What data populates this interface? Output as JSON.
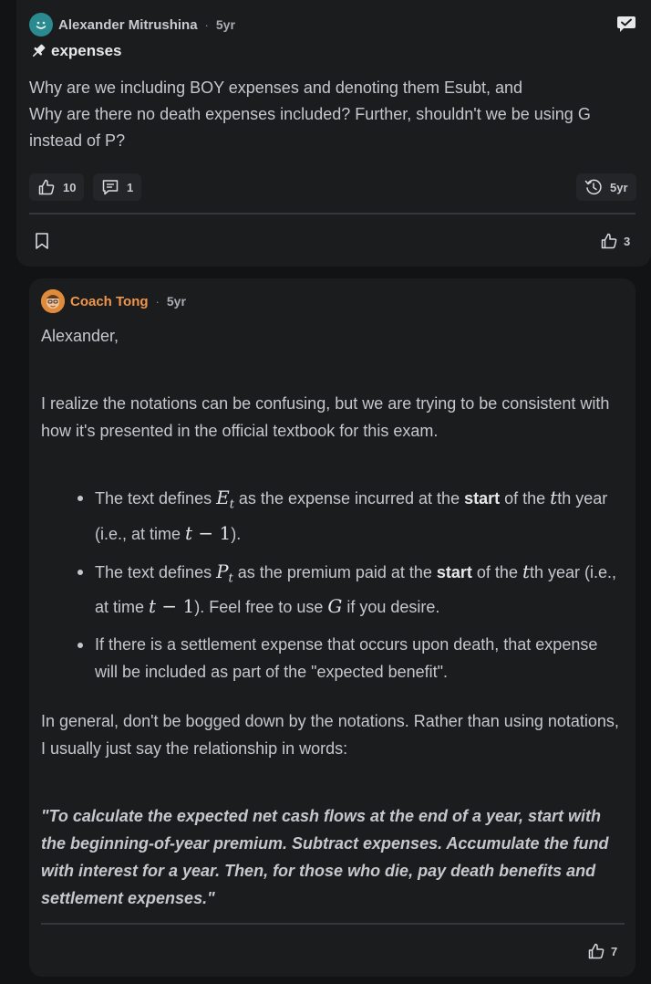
{
  "post": {
    "author": "Alexander Mitrushina",
    "time": "5yr",
    "title": "expenses",
    "body_line1": "Why are we including BOY expenses and denoting them Esubt, and",
    "body_line2": "Why are there no death expenses included? Further, shouldn't we be using G instead of P?",
    "likes": "10",
    "comments": "1",
    "history_label": "5yr",
    "reply_likes": "3"
  },
  "reply": {
    "author": "Coach Tong",
    "time": "5yr",
    "greeting": "Alexander,",
    "para1": "I realize the notations can be confusing, but we are trying to be consistent with how it's presented in the official textbook for this exam.",
    "b1_pre": "The text defines ",
    "b1_sym": "E",
    "b1_sub": "t",
    "b1_mid": " as the expense incurred at the ",
    "b1_bold": "start",
    "b1_of": " of the ",
    "b1_t": "t",
    "b1_th": "th year (i.e., at time ",
    "b1_expr": "t",
    "b1_expr2": " − 1",
    "b1_end": ").",
    "b2_pre": "The text defines ",
    "b2_sym": "P",
    "b2_sub": "t",
    "b2_mid": " as the premium paid at the ",
    "b2_bold": "start",
    "b2_of": " of the ",
    "b2_t": "t",
    "b2_th": "th year (i.e., at time ",
    "b2_expr": "t",
    "b2_expr2": " − 1",
    "b2_end": "). Feel free to use ",
    "b2_g": "G",
    "b2_tail": " if you desire.",
    "b3": "If there is a settlement expense that occurs upon death, that expense will be included as part of the \"expected benefit\".",
    "para2": "In general, don't be bogged down by the notations. Rather than using notations, I usually just say the relationship in words:",
    "quote": "\"To calculate the expected net cash flows at the end of a year, start with the beginning-of-year premium. Subtract expenses. Accumulate the fund with interest for a year. Then, for those who die, pay death benefits and settlement expenses.\"",
    "likes": "7"
  },
  "colors": {
    "accent": "#f0954a",
    "background": "#121314",
    "card": "#1b1c1e"
  }
}
